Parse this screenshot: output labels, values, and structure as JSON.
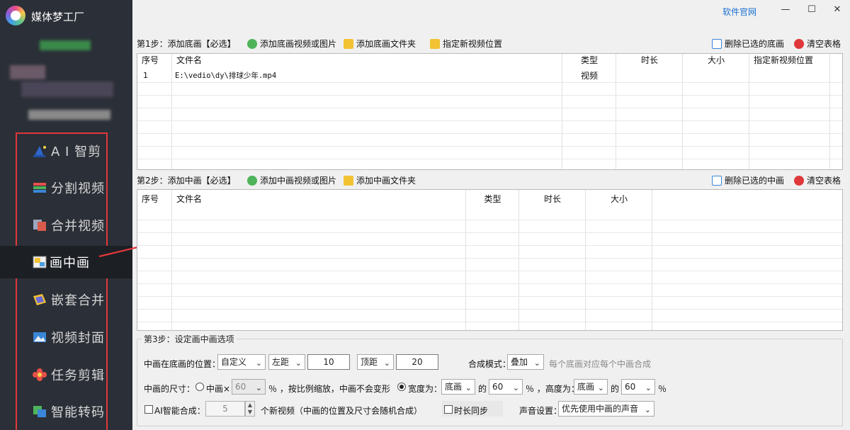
{
  "app": {
    "title": "媒体梦工厂",
    "official_link": "软件官网"
  },
  "sidebar": {
    "items": [
      {
        "label": "A I 智剪",
        "icon": "wizard-hat-icon"
      },
      {
        "label": "分割视频",
        "icon": "split-video-icon"
      },
      {
        "label": "合并视频",
        "icon": "merge-video-icon"
      },
      {
        "label": "画中画",
        "icon": "picture-in-picture-icon"
      },
      {
        "label": "嵌套合并",
        "icon": "nested-merge-icon"
      },
      {
        "label": "视频封面",
        "icon": "video-cover-icon"
      },
      {
        "label": "任务剪辑",
        "icon": "flower-icon"
      },
      {
        "label": "智能转码",
        "icon": "transcode-icon"
      }
    ],
    "active_index": 3
  },
  "window": {
    "minimize": "—",
    "maximize": "☐",
    "close": "✕"
  },
  "step1": {
    "title": "第1步：添加底画【必选】",
    "add_video": "添加底画视频或图片",
    "add_folder": "添加底画文件夹",
    "set_position": "指定新视频位置",
    "delete_selected": "删除已选的底画",
    "clear": "清空表格",
    "columns": {
      "index": "序号",
      "filename": "文件名",
      "type": "类型",
      "duration": "时长",
      "size": "大小",
      "newpos": "指定新视频位置"
    },
    "rows": [
      {
        "index": "1",
        "filename": "E:\\vedio\\dy\\排球少年.mp4",
        "type": "视频",
        "duration": "",
        "size": "",
        "newpos": ""
      }
    ]
  },
  "step2": {
    "title": "第2步：添加中画【必选】",
    "add_video": "添加中画视频或图片",
    "add_folder": "添加中画文件夹",
    "delete_selected": "删除已选的中画",
    "clear": "清空表格",
    "columns": {
      "index": "序号",
      "filename": "文件名",
      "type": "类型",
      "duration": "时长",
      "size": "大小"
    },
    "rows": []
  },
  "step3": {
    "title": "第3步：设定画中画选项",
    "position_label": "中画在底画的位置：",
    "position_mode": "自定义",
    "horizontal_ref": "左距",
    "horizontal_value": "10",
    "vertical_ref": "顶距",
    "vertical_value": "20",
    "blend_label": "合成模式：",
    "blend_mode": "叠加",
    "blend_hint": "每个底画对应每个中画合成",
    "size_label": "中画的尺寸：",
    "scale_option": "中画×",
    "scale_value": "60",
    "scale_hint": "％ ，按比例缩放，中画不会变形",
    "width_option": "宽度为：",
    "width_ref": "底画",
    "of_text": "的",
    "width_value": "60",
    "percent_sep": "％ ，高度为：",
    "height_ref": "底画",
    "of_text2": "的",
    "height_value": "60",
    "percent": "％",
    "ai_label": "AI智能合成：",
    "ai_count": "5",
    "ai_hint": "个新视频（中画的位置及尺寸会随机合成）",
    "duration_sync": "时长同步",
    "audio_label": "声音设置：",
    "audio_option": "优先使用中画的声音"
  },
  "colors": {
    "sidebar_bg": "#2b2f37",
    "highlight": "#e0383a",
    "link": "#1a6fd1"
  }
}
